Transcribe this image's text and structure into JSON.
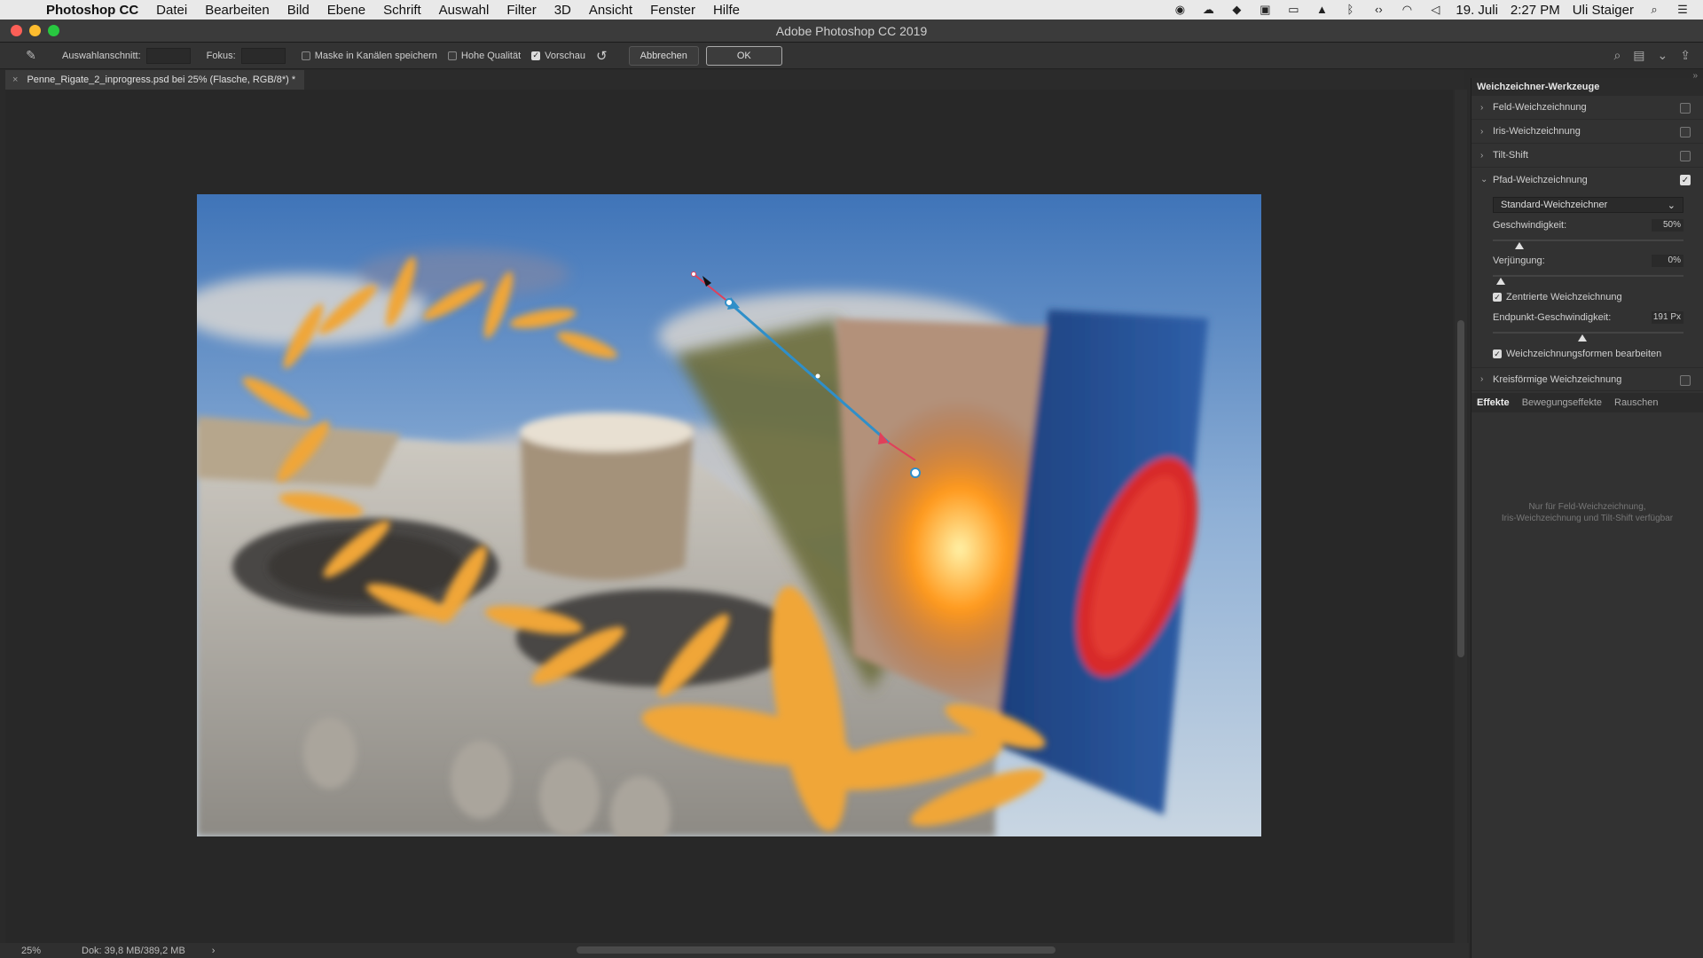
{
  "menubar": {
    "app": "Photoshop CC",
    "items": [
      "Datei",
      "Bearbeiten",
      "Bild",
      "Ebene",
      "Schrift",
      "Auswahl",
      "Filter",
      "3D",
      "Ansicht",
      "Fenster",
      "Hilfe"
    ],
    "date": "19. Juli",
    "time": "2:27 PM",
    "user": "Uli Staiger"
  },
  "window": {
    "title": "Adobe Photoshop CC 2019"
  },
  "options": {
    "selection_label": "Auswahlanschnitt:",
    "focus_label": "Fokus:",
    "mask_label": "Maske in Kanälen speichern",
    "quality_label": "Hohe Qualität",
    "preview_label": "Vorschau",
    "cancel_label": "Abbrechen",
    "ok_label": "OK"
  },
  "document": {
    "tab_title": "Penne_Rigate_2_inprogress.psd bei 25% (Flasche, RGB/8*) *"
  },
  "status": {
    "zoom": "25%",
    "doc": "Dok: 39,8 MB/389,2 MB",
    "arrow": "›"
  },
  "panel": {
    "title": "Weichzeichner-Werkzeuge",
    "rows": [
      {
        "label": "Feld-Weichzeichnung",
        "checked": false
      },
      {
        "label": "Iris-Weichzeichnung",
        "checked": false
      },
      {
        "label": "Tilt-Shift",
        "checked": false
      },
      {
        "label": "Pfad-Weichzeichnung",
        "checked": true
      }
    ],
    "path_blur": {
      "mode": "Standard-Weichzeichner",
      "speed_label": "Geschwindigkeit:",
      "speed_value": "50%",
      "taper_label": "Verjüngung:",
      "taper_value": "0%",
      "centered_label": "Zentrierte Weichzeichnung",
      "endpoint_label": "Endpunkt-Geschwindigkeit:",
      "endpoint_value": "191 Px",
      "edit_shapes_label": "Weichzeichnungsformen bearbeiten"
    },
    "spin_blur_label": "Kreisförmige Weichzeichnung",
    "tabs": [
      "Effekte",
      "Bewegungseffekte",
      "Rauschen"
    ],
    "note_line1": "Nur für Feld-Weichzeichnung,",
    "note_line2": "Iris-Weichzeichnung und Tilt-Shift verfügbar"
  },
  "colors": {
    "accent_path": "#2f8fc9",
    "handle_red": "#e0405a",
    "panel_bg": "#323232"
  }
}
